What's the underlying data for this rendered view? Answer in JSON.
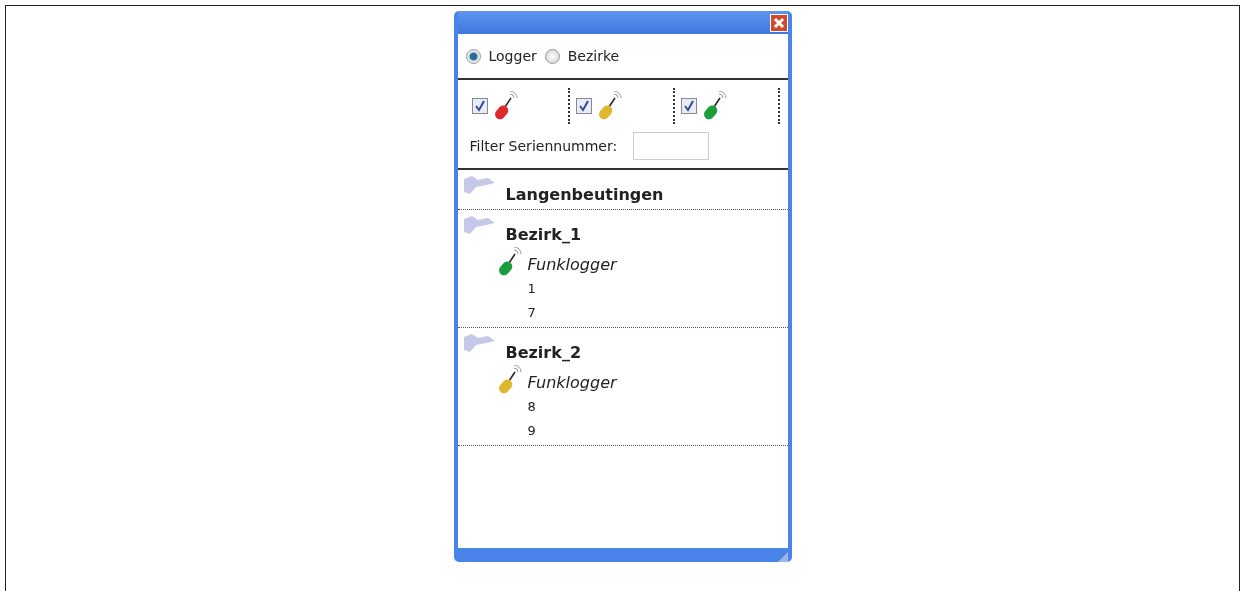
{
  "modes": [
    {
      "label": "Logger",
      "selected": true
    },
    {
      "label": "Bezirke",
      "selected": false
    }
  ],
  "logger_filters": [
    {
      "checked": true,
      "color": "#dd2a2a"
    },
    {
      "checked": true,
      "color": "#e0b830"
    },
    {
      "checked": true,
      "color": "#1c9c3a"
    }
  ],
  "serial_filter": {
    "label": "Filter Seriennummer:"
  },
  "districts": [
    {
      "name": "Langenbeutingen"
    },
    {
      "name": "Bezirk_1",
      "children": [
        {
          "label": "Funklogger",
          "color": "#1c9c3a",
          "children": [
            {
              "label": "1"
            },
            {
              "label": "7"
            }
          ]
        }
      ]
    },
    {
      "name": "Bezirk_2",
      "children": [
        {
          "label": "Funklogger",
          "color": "#e0b830",
          "children": [
            {
              "label": "8"
            },
            {
              "label": "9"
            }
          ]
        }
      ]
    }
  ]
}
